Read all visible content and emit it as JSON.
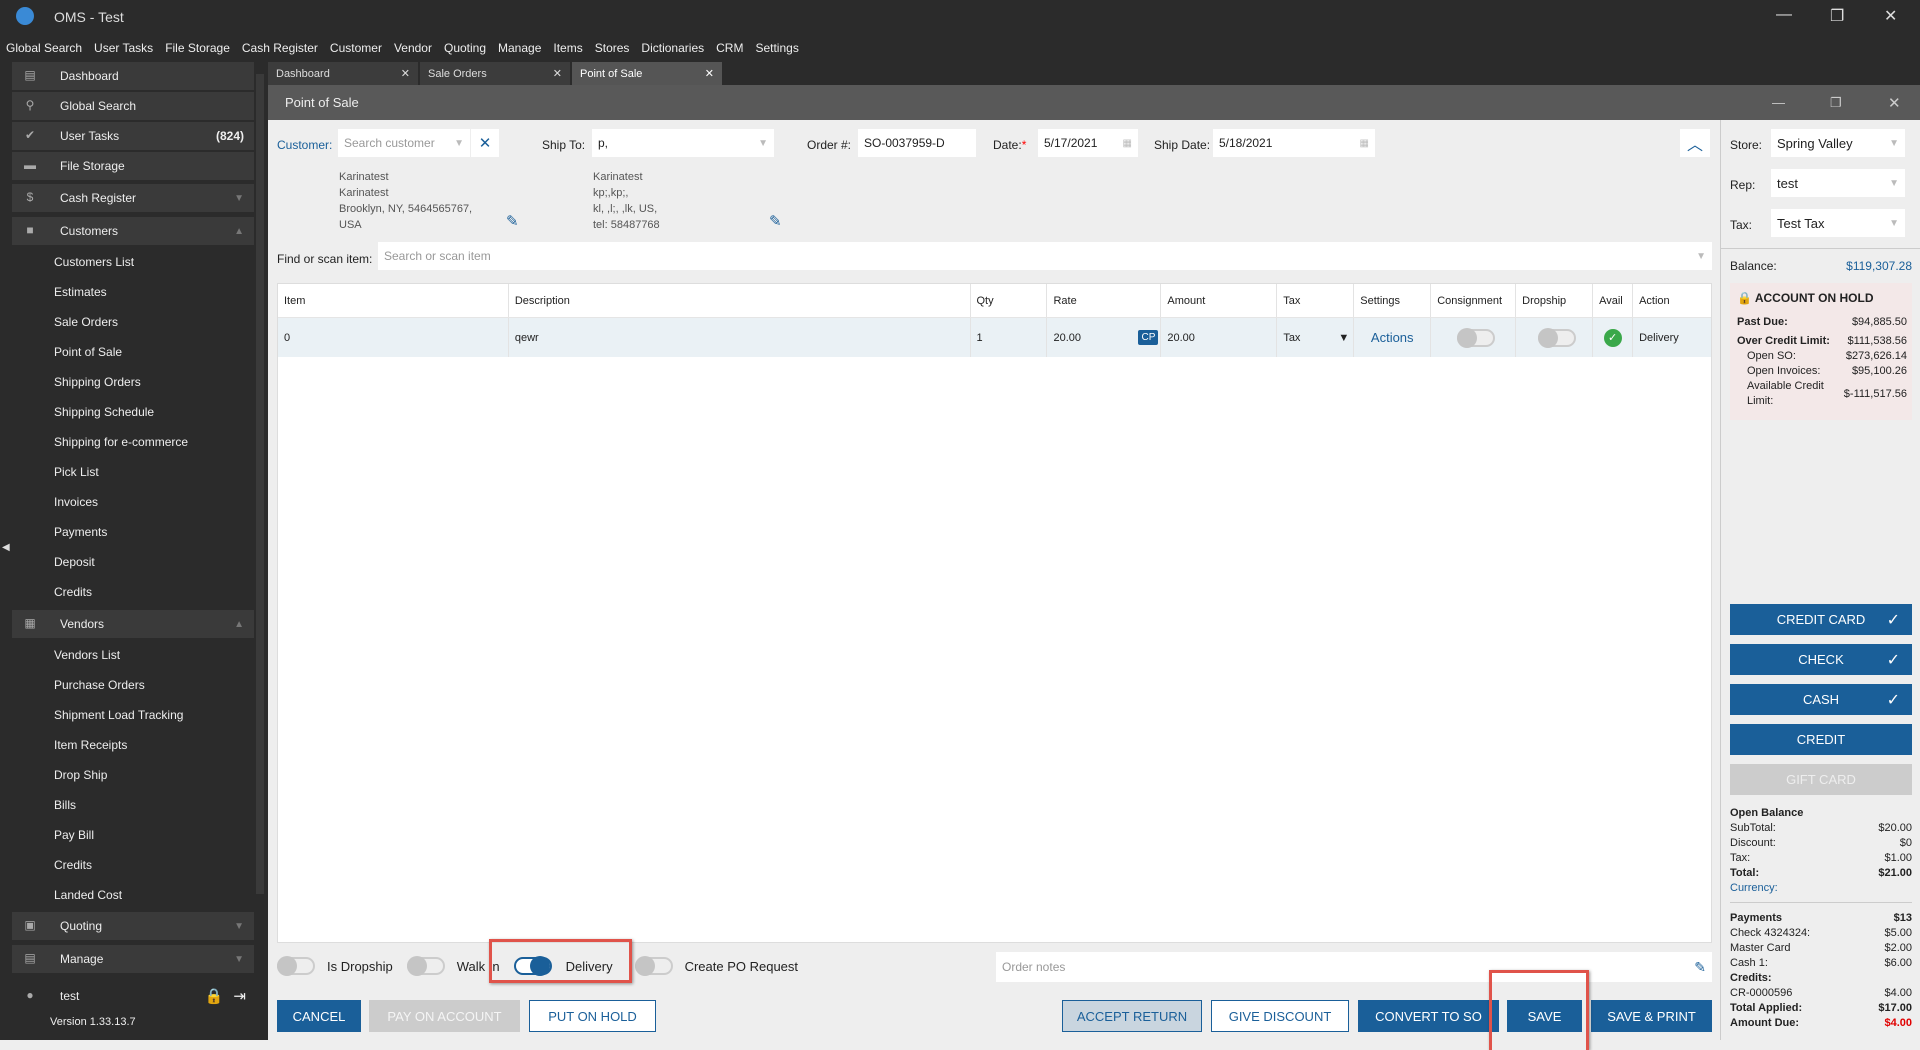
{
  "app": {
    "title": "OMS - Test"
  },
  "menu": [
    "Global Search",
    "User Tasks",
    "File Storage",
    "Cash Register",
    "Customer",
    "Vendor",
    "Quoting",
    "Manage",
    "Items",
    "Stores",
    "Dictionaries",
    "CRM",
    "Settings"
  ],
  "sidebar": {
    "top": [
      {
        "label": "Dashboard",
        "icon": "dashboard-icon"
      },
      {
        "label": "Global Search",
        "icon": "search-icon"
      },
      {
        "label": "User Tasks",
        "icon": "check-circle-icon",
        "count": "(824)"
      },
      {
        "label": "File Storage",
        "icon": "folder-icon"
      },
      {
        "label": "Cash Register",
        "icon": "dollar-icon"
      },
      {
        "label": "Customers",
        "icon": "person-icon"
      }
    ],
    "customers": [
      "Customers List",
      "Estimates",
      "Sale Orders",
      "Point of Sale",
      "Shipping Orders",
      "Shipping Schedule",
      "Shipping for e-commerce",
      "Pick List",
      "Invoices",
      "Payments",
      "Deposit",
      "Credits"
    ],
    "vendors_label": "Vendors",
    "vendors": [
      "Vendors List",
      "Purchase Orders",
      "Shipment Load Tracking",
      "Item Receipts",
      "Drop Ship",
      "Bills",
      "Pay Bill",
      "Credits",
      "Landed Cost"
    ],
    "quoting": "Quoting",
    "manage": "Manage",
    "user": "test",
    "version": "Version 1.33.13.7"
  },
  "tabs": [
    "Dashboard",
    "Sale Orders",
    "Point of Sale"
  ],
  "window_title": "Point of Sale",
  "header": {
    "customer_label": "Customer:",
    "customer_placeholder": "Search customer",
    "ship_to_label": "Ship To:",
    "ship_to_value": "p,",
    "order_label": "Order #:",
    "order_value": "SO-0037959-D",
    "date_label": "Date:",
    "date_value": "5/17/2021",
    "ship_date_label": "Ship Date:",
    "ship_date_value": "5/18/2021",
    "customer_address": [
      "Karinatest",
      "Karinatest",
      "Brooklyn, NY, 5464565767,",
      "USA"
    ],
    "ship_address": [
      "Karinatest",
      "kp;,kp;,",
      "kl, ,l;, ,lk, US,",
      "tel: 58487768"
    ],
    "find_label": "Find or scan item:",
    "find_placeholder": "Search or scan item"
  },
  "table": {
    "columns": [
      "Item",
      "Description",
      "Qty",
      "Rate",
      "Amount",
      "Tax",
      "Settings",
      "Consignment",
      "Dropship",
      "Avail",
      "Action"
    ],
    "rows": [
      {
        "item": "0",
        "description": "qewr",
        "qty": "1",
        "rate": "20.00",
        "badge": "CP",
        "amount": "20.00",
        "tax": "Tax",
        "settings": "Actions",
        "action": "Delivery"
      }
    ]
  },
  "options": {
    "is_dropship": "Is Dropship",
    "walk_in": "Walk In",
    "delivery": "Delivery",
    "create_po": "Create PO Request",
    "notes_placeholder": "Order notes"
  },
  "buttons": {
    "cancel": "Cancel",
    "pay_on_account": "Pay on account",
    "put_on_hold": "Put on hold",
    "accept_return": "Accept return",
    "give_discount": "Give discount",
    "convert_to_so": "Convert to SO",
    "save": "Save",
    "save_print": "Save & Print"
  },
  "right": {
    "store_label": "Store:",
    "store": "Spring Valley",
    "rep_label": "Rep:",
    "rep": "test",
    "tax_label": "Tax:",
    "tax": "Test Tax",
    "balance_label": "Balance:",
    "balance": "$119,307.28",
    "hold_title": "ACCOUNT ON HOLD",
    "past_due_label": "Past Due:",
    "past_due": "$94,885.50",
    "over_label": "Over Credit Limit:",
    "over": "$111,538.56",
    "open_so_label": "Open SO:",
    "open_so": "$273,626.14",
    "open_inv_label": "Open Invoices:",
    "open_inv": "$95,100.26",
    "avail_label": "Available Credit Limit:",
    "avail": "$-111,517.56",
    "pay_buttons": [
      "CREDIT CARD",
      "CHECK",
      "CASH",
      "CREDIT",
      "GIFT CARD"
    ],
    "open_balance": "Open Balance",
    "subtotal_label": "SubTotal:",
    "subtotal": "$20.00",
    "discount_label": "Discount:",
    "discount": "$0",
    "tax_amt_label": "Tax:",
    "tax_amt": "$1.00",
    "total_label": "Total:",
    "total": "$21.00",
    "currency_label": "Currency:",
    "payments_label": "Payments",
    "payments": "$13",
    "check_label": "Check 4324324:",
    "check": "$5.00",
    "mc_label": "Master Card",
    "mc": "$2.00",
    "cash_label": "Cash 1:",
    "cash": "$6.00",
    "credits_label": "Credits:",
    "cr_label": "CR-0000596",
    "cr": "$4.00",
    "applied_label": "Total Applied:",
    "applied": "$17.00",
    "due_label": "Amount Due:",
    "due": "$4.00"
  },
  "colors": {
    "accent": "#1a5f99",
    "due": "#e00000",
    "hold_bg": "#f3e8e8"
  }
}
